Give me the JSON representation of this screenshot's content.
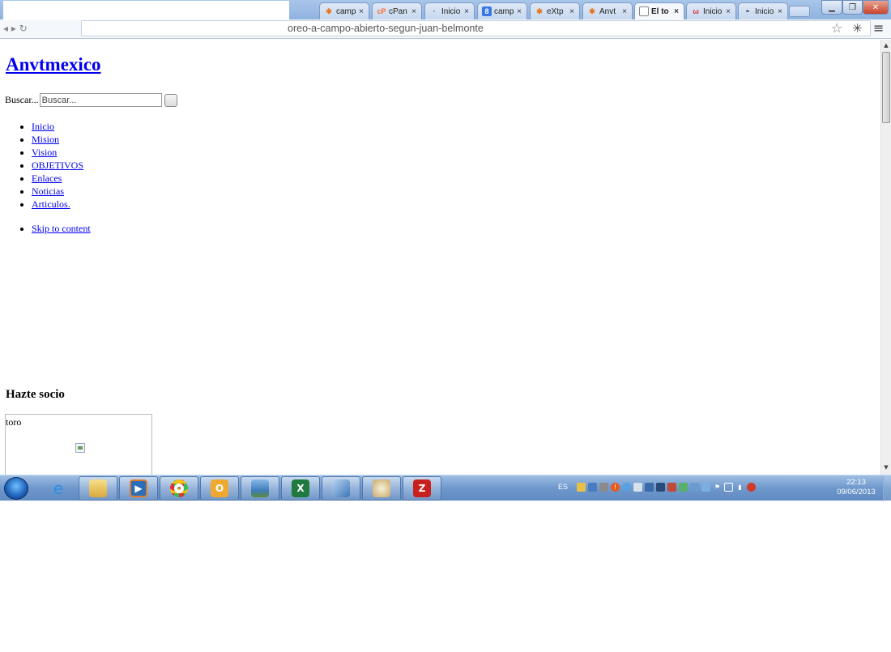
{
  "browser": {
    "tabs": [
      {
        "label": "camp",
        "favicon": "joomla-icon",
        "active": false
      },
      {
        "label": "cPan",
        "favicon": "cpanel-icon",
        "active": false
      },
      {
        "label": "Inicio",
        "favicon": "loading-icon",
        "active": false
      },
      {
        "label": "camp",
        "favicon": "google-icon",
        "active": false
      },
      {
        "label": "eXtp",
        "favicon": "joomla-icon",
        "active": false
      },
      {
        "label": "Anvt",
        "favicon": "joomla-icon",
        "active": false
      },
      {
        "label": "El to",
        "favicon": "page-icon",
        "active": true
      },
      {
        "label": "Inicio",
        "favicon": "webmail-icon",
        "active": false
      },
      {
        "label": "Inicio",
        "favicon": "hat-icon",
        "active": false
      }
    ],
    "tab_close": "×",
    "url_visible": "oreo-a-campo-abierto-segun-juan-belmonte"
  },
  "page": {
    "site_title": "Anvtmexico",
    "search_label": "Buscar...",
    "search_placeholder": "Buscar...",
    "menu": [
      "Inicio",
      "Mision",
      "Vision",
      "OBJETIVOS",
      "Enlaces",
      "Noticias",
      "Articulos."
    ],
    "skip_link": "Skip to content",
    "hazte_heading": "Hazte socio",
    "toro_label": "toro"
  },
  "taskbar": {
    "language": "ES",
    "time": "22:13",
    "date": "09/06/2013"
  },
  "colors": {
    "link": "#0000ee",
    "tabstrip": "#a9c6ea",
    "taskbar": "#6f98cc"
  }
}
